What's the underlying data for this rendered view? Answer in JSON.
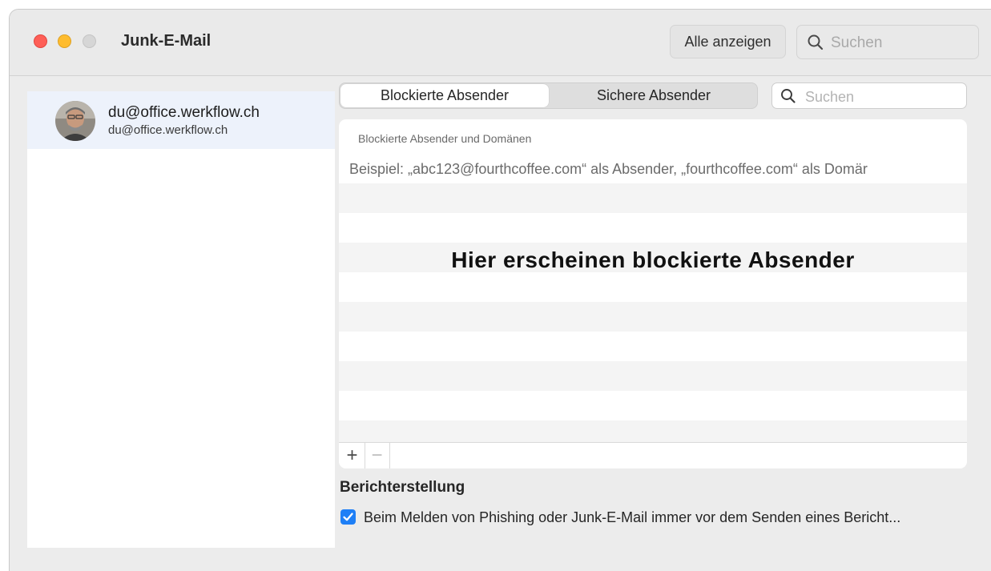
{
  "window": {
    "title": "Junk-E-Mail",
    "show_all_label": "Alle anzeigen",
    "search_placeholder": "Suchen"
  },
  "sidebar": {
    "account": {
      "name": "du@office.werkflow.ch",
      "subtitle": "du@office.werkflow.ch"
    }
  },
  "tabs": [
    {
      "label": "Blockierte Absender",
      "selected": true
    },
    {
      "label": "Sichere Absender",
      "selected": false
    }
  ],
  "list_search": {
    "placeholder": "Suchen"
  },
  "list": {
    "header": "Blockierte Absender und Domänen",
    "hint": "Beispiel: „abc123@fourthcoffee.com“ als Absender, „fourthcoffee.com“ als Domär",
    "overlay_annotation": "Hier erscheinen blockierte Absender",
    "add_label": "+",
    "remove_label": "−"
  },
  "reporting": {
    "title": "Berichterstellung",
    "checkbox_label": "Beim Melden von Phishing oder Junk-E-Mail immer vor dem Senden eines Bericht...",
    "checked": true
  },
  "colors": {
    "accent": "#1e7ff6",
    "close": "#fe5f57",
    "minimize": "#febc2e",
    "zoom_disabled": "#d6d6d6"
  }
}
